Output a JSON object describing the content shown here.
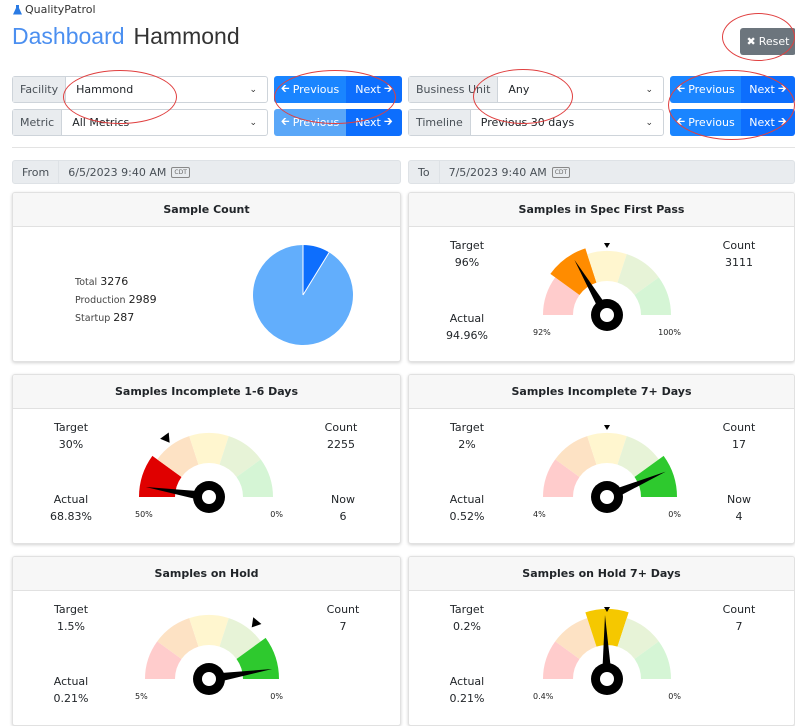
{
  "app": {
    "name": "QualityPatrol"
  },
  "header": {
    "title": "Dashboard",
    "subtitle": "Hammond",
    "reset_label": "Reset"
  },
  "filters": {
    "facility": {
      "label": "Facility",
      "value": "Hammond"
    },
    "metric": {
      "label": "Metric",
      "value": "All Metrics"
    },
    "business_unit": {
      "label": "Business Unit",
      "value": "Any"
    },
    "timeline": {
      "label": "Timeline",
      "value": "Previous 30 days"
    },
    "previous_label": "Previous",
    "next_label": "Next"
  },
  "range": {
    "from_label": "From",
    "from_value": "6/5/2023 9:40 AM",
    "to_label": "To",
    "to_value": "7/5/2023 9:40 AM",
    "tz": "CDT"
  },
  "cards": {
    "sample_count": {
      "title": "Sample Count",
      "total_label": "Total",
      "total": "3276",
      "production_label": "Production",
      "production": "2989",
      "startup_label": "Startup",
      "startup": "287"
    },
    "spec_first_pass": {
      "title": "Samples in Spec First Pass",
      "target_label": "Target",
      "target": "96%",
      "count_label": "Count",
      "count": "3111",
      "actual_label": "Actual",
      "actual": "94.96%",
      "gauge_min": "92%",
      "gauge_max": "100%"
    },
    "incomplete_1_6": {
      "title": "Samples Incomplete 1-6 Days",
      "target_label": "Target",
      "target": "30%",
      "count_label": "Count",
      "count": "2255",
      "actual_label": "Actual",
      "actual": "68.83%",
      "now_label": "Now",
      "now": "6",
      "gauge_min": "50%",
      "gauge_max": "0%"
    },
    "incomplete_7": {
      "title": "Samples Incomplete 7+ Days",
      "target_label": "Target",
      "target": "2%",
      "count_label": "Count",
      "count": "17",
      "actual_label": "Actual",
      "actual": "0.52%",
      "now_label": "Now",
      "now": "4",
      "gauge_min": "4%",
      "gauge_max": "0%"
    },
    "on_hold": {
      "title": "Samples on Hold",
      "target_label": "Target",
      "target": "1.5%",
      "count_label": "Count",
      "count": "7",
      "actual_label": "Actual",
      "actual": "0.21%",
      "gauge_min": "5%",
      "gauge_max": "0%"
    },
    "on_hold_7": {
      "title": "Samples on Hold 7+ Days",
      "target_label": "Target",
      "target": "0.2%",
      "count_label": "Count",
      "count": "7",
      "actual_label": "Actual",
      "actual": "0.21%",
      "gauge_min": "0.4%",
      "gauge_max": "0%"
    }
  },
  "chart_data": [
    {
      "type": "pie",
      "categories": [
        "Production",
        "Startup"
      ],
      "values": [
        2989,
        287
      ],
      "colors": [
        "#62aefc",
        "#0d6efd"
      ]
    }
  ],
  "colors": {
    "accent": "#0d6efd",
    "gauge_bands": [
      "#ffcccc",
      "#fde2c4",
      "#fff6cf",
      "#e7f3d7",
      "#d5f5d5"
    ],
    "gauge_bright": [
      "#e00000",
      "#ff8c00",
      "#f5c800",
      "#9fd36b",
      "#2ec92e"
    ]
  }
}
